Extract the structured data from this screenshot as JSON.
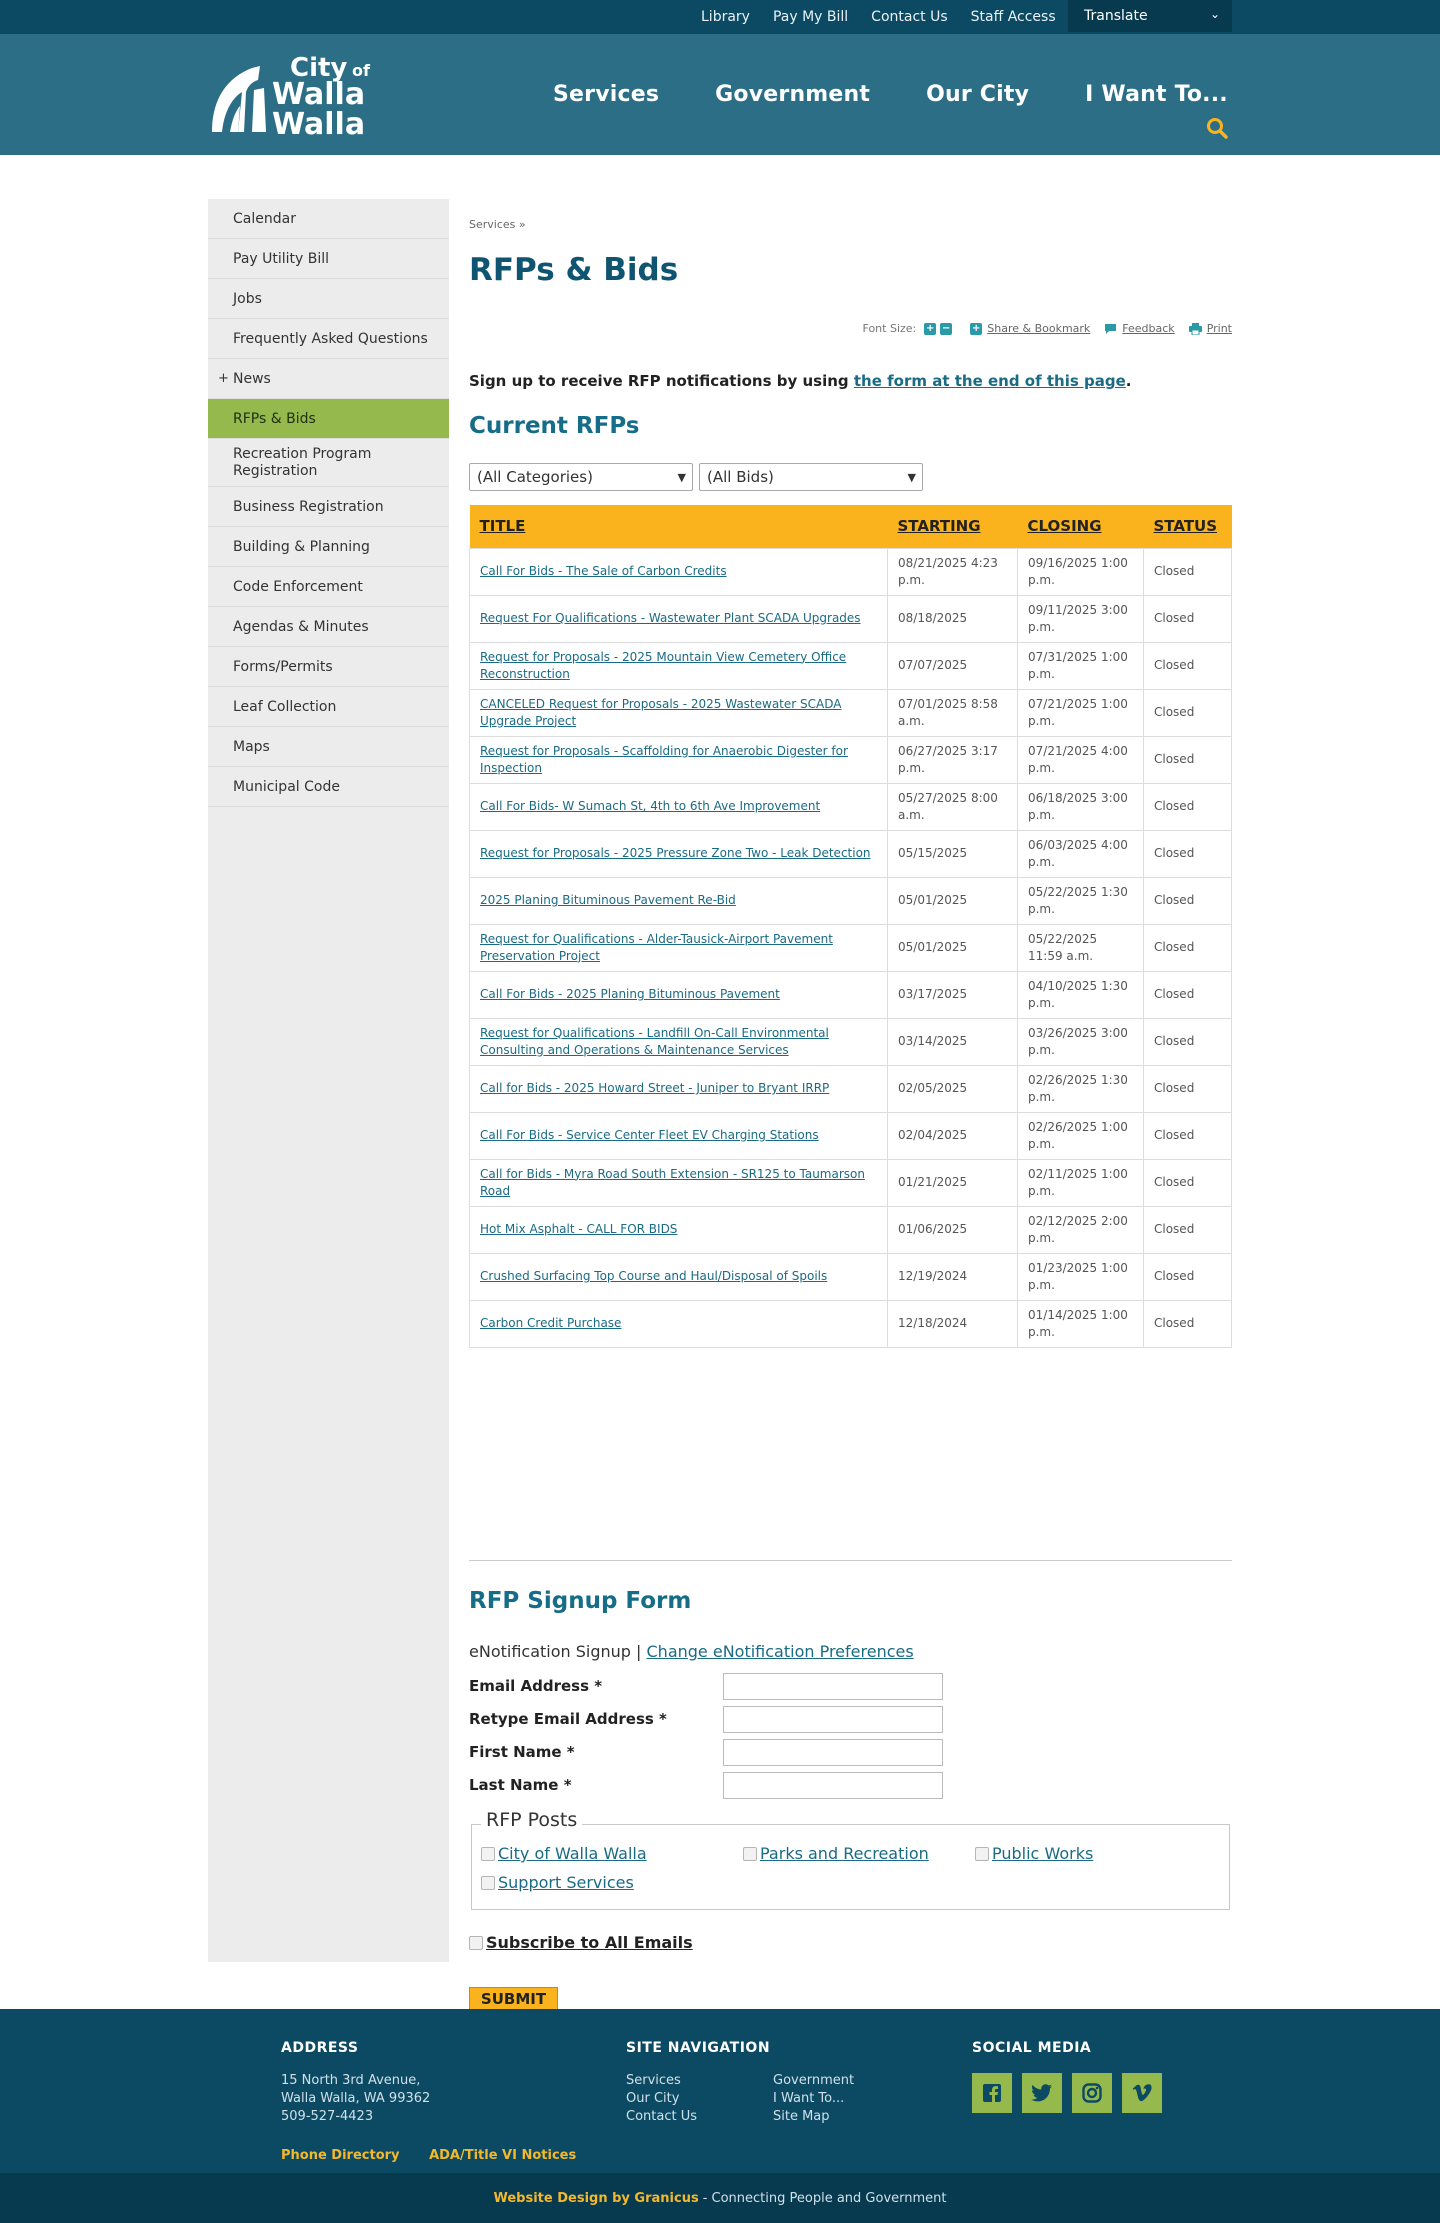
{
  "util_nav": {
    "items": [
      "Library",
      "Pay My Bill",
      "Contact Us",
      "Staff Access"
    ],
    "translate": "Translate"
  },
  "logo": {
    "line1": "City",
    "line1b": "of",
    "line2": "Walla",
    "line3": "Walla"
  },
  "main_nav": [
    "Services",
    "Government",
    "Our City",
    "I Want To..."
  ],
  "sidebar": [
    {
      "label": "Calendar"
    },
    {
      "label": "Pay Utility Bill"
    },
    {
      "label": "Jobs"
    },
    {
      "label": "Frequently Asked Questions"
    },
    {
      "label": "News",
      "expand": "+"
    },
    {
      "label": "RFPs & Bids",
      "active": true
    },
    {
      "label": "Recreation Program Registration"
    },
    {
      "label": "Business Registration"
    },
    {
      "label": "Building & Planning"
    },
    {
      "label": "Code Enforcement"
    },
    {
      "label": "Agendas & Minutes"
    },
    {
      "label": "Forms/Permits"
    },
    {
      "label": "Leaf Collection"
    },
    {
      "label": "Maps"
    },
    {
      "label": "Municipal Code"
    }
  ],
  "page": {
    "breadcrumb": "Services »",
    "title": "RFPs & Bids",
    "tools": {
      "font_size": "Font Size:",
      "plus": "+",
      "minus": "−",
      "share": "Share & Bookmark",
      "feedback": "Feedback",
      "print": "Print"
    },
    "intro_text": "Sign up to receive RFP notifications by using ",
    "intro_link": "the form at the end of this page",
    "intro_end": ".",
    "current_heading": "Current RFPs",
    "filter_category": "(All Categories)",
    "filter_bids": "(All Bids)"
  },
  "table": {
    "columns": [
      "TITLE",
      "STARTING",
      "CLOSING",
      "STATUS"
    ],
    "rows": [
      {
        "title": "Call For Bids - The Sale of Carbon Credits",
        "starting": "08/21/2025 4:23 p.m.",
        "closing": "09/16/2025 1:00 p.m.",
        "status": "Closed"
      },
      {
        "title": "Request For Qualifications - Wastewater Plant SCADA Upgrades",
        "starting": "08/18/2025",
        "closing": "09/11/2025 3:00 p.m.",
        "status": "Closed"
      },
      {
        "title": "Request for Proposals - 2025 Mountain View Cemetery Office Reconstruction",
        "starting": "07/07/2025",
        "closing": "07/31/2025 1:00 p.m.",
        "status": "Closed"
      },
      {
        "title": "CANCELED Request for Proposals - 2025 Wastewater SCADA Upgrade Project",
        "starting": "07/01/2025 8:58 a.m.",
        "closing": "07/21/2025 1:00 p.m.",
        "status": "Closed"
      },
      {
        "title": "Request for Proposals - Scaffolding for Anaerobic Digester for Inspection",
        "starting": "06/27/2025 3:17 p.m.",
        "closing": "07/21/2025 4:00 p.m.",
        "status": "Closed"
      },
      {
        "title": "Call For Bids- W Sumach St, 4th to 6th Ave Improvement",
        "starting": "05/27/2025 8:00 a.m.",
        "closing": "06/18/2025 3:00 p.m.",
        "status": "Closed"
      },
      {
        "title": "Request for Proposals - 2025 Pressure Zone Two - Leak Detection",
        "starting": "05/15/2025",
        "closing": "06/03/2025 4:00 p.m.",
        "status": "Closed"
      },
      {
        "title": "2025 Planing Bituminous Pavement Re-Bid",
        "starting": "05/01/2025",
        "closing": "05/22/2025 1:30 p.m.",
        "status": "Closed"
      },
      {
        "title": "Request for Qualifications - Alder-Tausick-Airport Pavement Preservation Project",
        "starting": "05/01/2025",
        "closing": "05/22/2025 11:59 a.m.",
        "status": "Closed"
      },
      {
        "title": "Call For Bids - 2025 Planing Bituminous Pavement",
        "starting": "03/17/2025",
        "closing": "04/10/2025 1:30 p.m.",
        "status": "Closed"
      },
      {
        "title": "Request for Qualifications - Landfill On-Call Environmental Consulting and Operations & Maintenance Services",
        "starting": "03/14/2025",
        "closing": "03/26/2025 3:00 p.m.",
        "status": "Closed"
      },
      {
        "title": "Call for Bids - 2025 Howard Street - Juniper to Bryant IRRP",
        "starting": "02/05/2025",
        "closing": "02/26/2025 1:30 p.m.",
        "status": "Closed"
      },
      {
        "title": "Call For Bids - Service Center Fleet EV Charging Stations",
        "starting": "02/04/2025",
        "closing": "02/26/2025 1:00 p.m.",
        "status": "Closed"
      },
      {
        "title": "Call for Bids - Myra Road South Extension - SR125 to Taumarson Road",
        "starting": "01/21/2025",
        "closing": "02/11/2025 1:00 p.m.",
        "status": "Closed"
      },
      {
        "title": "Hot Mix Asphalt - CALL FOR BIDS",
        "starting": "01/06/2025",
        "closing": "02/12/2025 2:00 p.m.",
        "status": "Closed"
      },
      {
        "title": "Crushed Surfacing Top Course and Haul/Disposal of Spoils",
        "starting": "12/19/2024",
        "closing": "01/23/2025 1:00 p.m.",
        "status": "Closed"
      },
      {
        "title": "Carbon Credit Purchase",
        "starting": "12/18/2024",
        "closing": "01/14/2025 1:00 p.m.",
        "status": "Closed"
      }
    ]
  },
  "signup": {
    "heading": "RFP Signup Form",
    "enote_prefix": "eNotification Signup | ",
    "enote_link": "Change eNotification Preferences",
    "fields": [
      {
        "label": "Email Address *"
      },
      {
        "label": "Retype Email Address *"
      },
      {
        "label": "First Name *"
      },
      {
        "label": "Last Name *"
      }
    ],
    "legend": "RFP Posts",
    "options": [
      "City of Walla Walla",
      "Parks and Recreation",
      "Public Works",
      "Support Services"
    ],
    "subscribe_all": "Subscribe to All Emails",
    "submit": "SUBMIT"
  },
  "footer": {
    "address_head": "ADDRESS",
    "address": [
      "15 North 3rd Avenue,",
      "Walla Walla, WA 99362",
      "509-527-4423"
    ],
    "links": [
      "Phone Directory",
      "ADA/Title VI Notices"
    ],
    "nav_head": "SITE NAVIGATION",
    "nav_col1": [
      "Services",
      "Our City",
      "Contact Us"
    ],
    "nav_col2": [
      "Government",
      "I Want To...",
      "Site Map"
    ],
    "social_head": "SOCIAL MEDIA",
    "social": [
      "facebook-icon",
      "twitter-icon",
      "instagram-icon",
      "vimeo-icon"
    ],
    "credit_link": "Website Design by Granicus",
    "credit_text": " - Connecting People and Government"
  },
  "colors": {
    "header": "#2b6e86",
    "dark": "#0c4a63",
    "accent": "#fbb31d",
    "active": "#96b94e"
  }
}
